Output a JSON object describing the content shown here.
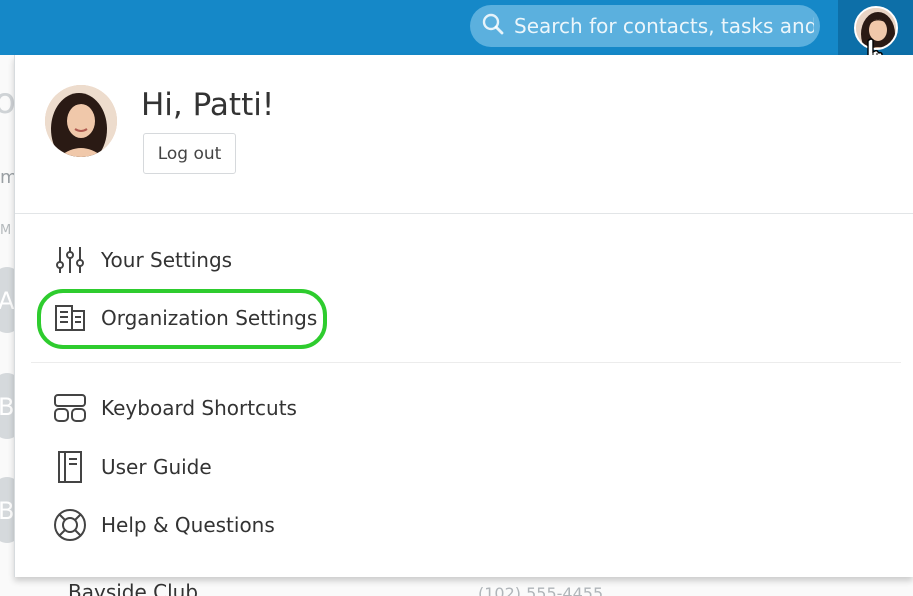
{
  "search": {
    "placeholder": "Search for contacts, tasks and t"
  },
  "profile": {
    "greeting": "Hi, Patti!",
    "logout_label": "Log out"
  },
  "menu": {
    "items": [
      {
        "label": "Your Settings",
        "icon": "sliders-icon"
      },
      {
        "label": "Organization Settings",
        "icon": "building-icon",
        "highlighted": true
      },
      {
        "label": "Keyboard Shortcuts",
        "icon": "keyboard-icon"
      },
      {
        "label": "User Guide",
        "icon": "book-icon"
      },
      {
        "label": "Help & Questions",
        "icon": "lifebuoy-icon"
      }
    ]
  },
  "background": {
    "page_title_fragment": "oar",
    "filter_fragment": "m",
    "column_fragment": "M",
    "row_letters": [
      "A",
      "B",
      "B"
    ],
    "bottom_row_name": "Bayside Club",
    "bottom_row_phone": "(102) 555-4455"
  },
  "colors": {
    "topbar": "#1588c8",
    "highlight": "#2ecc2e"
  }
}
